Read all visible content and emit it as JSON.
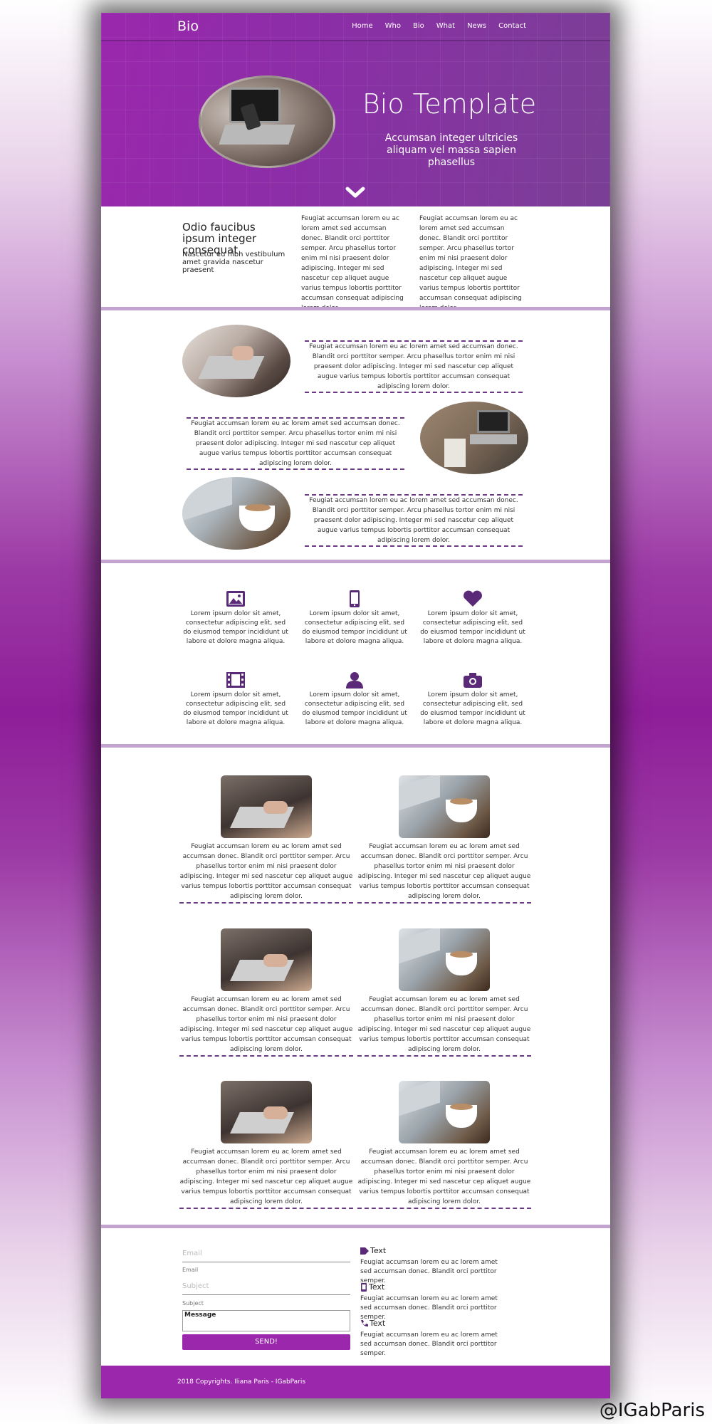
{
  "brand": "Bio",
  "nav": [
    "Home",
    "Who",
    "Bio",
    "What",
    "News",
    "Contact"
  ],
  "hero": {
    "title": "Bio Template",
    "subtitle": "Accumsan integer ultricies aliquam vel massa sapien phasellus"
  },
  "intro": {
    "heading": "Odio faucibus ipsum integer consequat",
    "subheading": "Nascetur eu nibh vestibulum amet gravida nascetur praesent",
    "col1": "Feugiat accumsan lorem eu ac lorem amet sed accumsan donec. Blandit orci porttitor semper. Arcu phasellus tortor enim mi nisi praesent dolor adipiscing. Integer mi sed nascetur cep aliquet augue varius tempus lobortis porttitor accumsan consequat adipiscing lorem dolor.",
    "col2": "Feugiat accumsan lorem eu ac lorem amet sed accumsan donec. Blandit orci porttitor semper. Arcu phasellus tortor enim mi nisi praesent dolor adipiscing. Integer mi sed nascetur cep aliquet augue varius tempus lobortis porttitor accumsan consequat adipiscing lorem dolor."
  },
  "spotlights": [
    "Feugiat accumsan lorem eu ac lorem amet sed accumsan donec. Blandit orci porttitor semper. Arcu phasellus tortor enim mi nisi praesent dolor adipiscing. Integer mi sed nascetur cep aliquet augue varius tempus lobortis porttitor accumsan consequat adipiscing lorem dolor.",
    "Feugiat accumsan lorem eu ac lorem amet sed accumsan donec. Blandit orci porttitor semper. Arcu phasellus tortor enim mi nisi praesent dolor adipiscing. Integer mi sed nascetur cep aliquet augue varius tempus lobortis porttitor accumsan consequat adipiscing lorem dolor.",
    "Feugiat accumsan lorem eu ac lorem amet sed accumsan donec. Blandit orci porttitor semper. Arcu phasellus tortor enim mi nisi praesent dolor adipiscing. Integer mi sed nascetur cep aliquet augue varius tempus lobortis porttitor accumsan consequat adipiscing lorem dolor."
  ],
  "features": [
    {
      "icon": "image-icon",
      "text": "Lorem ipsum dolor sit amet, consectetur adipiscing elit, sed do eiusmod tempor incididunt ut labore et dolore magna aliqua."
    },
    {
      "icon": "tablet-icon",
      "text": "Lorem ipsum dolor sit amet, consectetur adipiscing elit, sed do eiusmod tempor incididunt ut labore et dolore magna aliqua."
    },
    {
      "icon": "heart-icon",
      "text": "Lorem ipsum dolor sit amet, consectetur adipiscing elit, sed do eiusmod tempor incididunt ut labore et dolore magna aliqua."
    },
    {
      "icon": "film-icon",
      "text": "Lorem ipsum dolor sit amet, consectetur adipiscing elit, sed do eiusmod tempor incididunt ut labore et dolore magna aliqua."
    },
    {
      "icon": "user-icon",
      "text": "Lorem ipsum dolor sit amet, consectetur adipiscing elit, sed do eiusmod tempor incididunt ut labore et dolore magna aliqua."
    },
    {
      "icon": "camera-icon",
      "text": "Lorem ipsum dolor sit amet, consectetur adipiscing elit, sed do eiusmod tempor incididunt ut labore et dolore magna aliqua."
    }
  ],
  "gallery": [
    "Feugiat accumsan lorem eu ac lorem amet sed accumsan donec. Blandit orci porttitor semper. Arcu phasellus tortor enim mi nisi praesent dolor adipiscing. Integer mi sed nascetur cep aliquet augue varius tempus lobortis porttitor accumsan consequat adipiscing lorem dolor.",
    "Feugiat accumsan lorem eu ac lorem amet sed accumsan donec. Blandit orci porttitor semper. Arcu phasellus tortor enim mi nisi praesent dolor adipiscing. Integer mi sed nascetur cep aliquet augue varius tempus lobortis porttitor accumsan consequat adipiscing lorem dolor.",
    "Feugiat accumsan lorem eu ac lorem amet sed accumsan donec. Blandit orci porttitor semper. Arcu phasellus tortor enim mi nisi praesent dolor adipiscing. Integer mi sed nascetur cep aliquet augue varius tempus lobortis porttitor accumsan consequat adipiscing lorem dolor.",
    "Feugiat accumsan lorem eu ac lorem amet sed accumsan donec. Blandit orci porttitor semper. Arcu phasellus tortor enim mi nisi praesent dolor adipiscing. Integer mi sed nascetur cep aliquet augue varius tempus lobortis porttitor accumsan consequat adipiscing lorem dolor.",
    "Feugiat accumsan lorem eu ac lorem amet sed accumsan donec. Blandit orci porttitor semper. Arcu phasellus tortor enim mi nisi praesent dolor adipiscing. Integer mi sed nascetur cep aliquet augue varius tempus lobortis porttitor accumsan consequat adipiscing lorem dolor.",
    "Feugiat accumsan lorem eu ac lorem amet sed accumsan donec. Blandit orci porttitor semper. Arcu phasellus tortor enim mi nisi praesent dolor adipiscing. Integer mi sed nascetur cep aliquet augue varius tempus lobortis porttitor accumsan consequat adipiscing lorem dolor."
  ],
  "contact": {
    "email_placeholder": "Email",
    "email_label": "Email",
    "subject_placeholder": "Subject",
    "subject_label": "Subject",
    "message_label": "Message",
    "send_label": "SEND!",
    "items": [
      {
        "icon": "tag-icon",
        "title": "Text",
        "text": "Feugiat accumsan lorem eu ac lorem amet sed accumsan donec. Blandit orci porttitor semper."
      },
      {
        "icon": "tablet-icon",
        "title": "Text",
        "text": "Feugiat accumsan lorem eu ac lorem amet sed accumsan donec. Blandit orci porttitor semper."
      },
      {
        "icon": "phone-icon",
        "title": "Text",
        "text": "Feugiat accumsan lorem eu ac lorem amet sed accumsan donec. Blandit orci porttitor semper."
      }
    ]
  },
  "footer": "2018 Copyrights. Iliana Paris - IGabParis",
  "watermark": "@IGabParis",
  "colors": {
    "accent": "#9b27ad",
    "icon": "#5a2a78",
    "separator": "#c3a3d0"
  }
}
